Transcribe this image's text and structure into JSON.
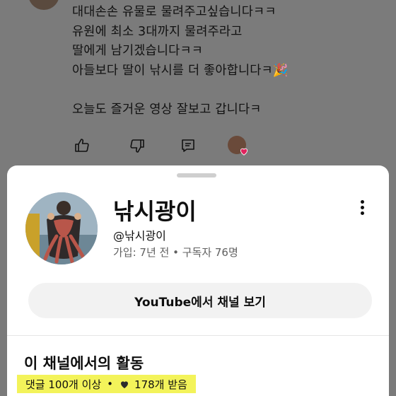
{
  "comment": {
    "lines": [
      "대대손손  유물로  물려주고싶습니다ㅋㅋ",
      "유원에  최소 3대까지  물려주라고",
      "딸에게  남기겠습니다ㅋㅋ",
      "아들보다 딸이  낚시를  더 좋아합니다ㅋ🎉",
      "",
      "오늘도 즐거운 영상 잘보고 갑니다ㅋ"
    ],
    "icons": [
      "like-icon",
      "dislike-icon",
      "reply-icon",
      "creator-heart-icon"
    ]
  },
  "channel": {
    "name": "낚시광이",
    "handle": "@낚시광이",
    "meta": "가입: 7년 전 • 구독자 76명",
    "view_button": "YouTube에서 채널 보기"
  },
  "activity": {
    "title": "이 채널에서의 활동",
    "comments": "댓글 100개 이상",
    "separator": "•",
    "likes": "178개 받음"
  },
  "colors": {
    "overlay": "#7a7a7a",
    "highlight": "#f3f35a",
    "heart_red": "#e0245e"
  }
}
